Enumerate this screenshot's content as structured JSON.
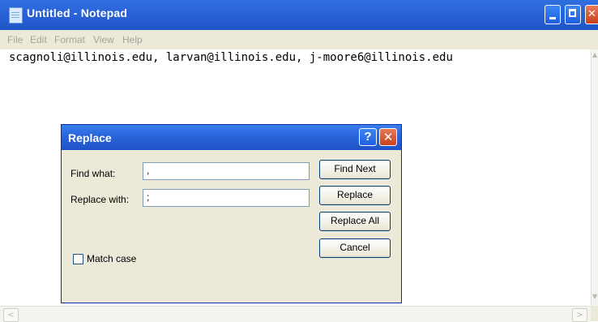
{
  "window": {
    "title": "Untitled - Notepad"
  },
  "menu": [
    "File",
    "Edit",
    "Format",
    "View",
    "Help"
  ],
  "editor": {
    "text": "scagnoli@illinois.edu, larvan@illinois.edu, j-moore6@illinois.edu"
  },
  "dialog": {
    "title": "Replace",
    "help_glyph": "?",
    "close_glyph": "✕",
    "find_label": "Find what:",
    "find_value": ",",
    "replace_label": "Replace with:",
    "replace_value": ";",
    "buttons": {
      "find_next": "Find Next",
      "replace": "Replace",
      "replace_all": "Replace All",
      "cancel": "Cancel"
    },
    "match_case_label": "Match case",
    "match_case_checked": false
  },
  "colors": {
    "titlebar": "#2a63d7",
    "dialog_face": "#ece9d8",
    "menu_disabled_text": "#a8a39a"
  },
  "icons": [
    "notepad-icon",
    "minimize-icon",
    "maximize-icon",
    "close-icon",
    "help-icon",
    "scroll-up-icon",
    "scroll-down-icon",
    "scroll-left-icon",
    "scroll-right-icon"
  ]
}
